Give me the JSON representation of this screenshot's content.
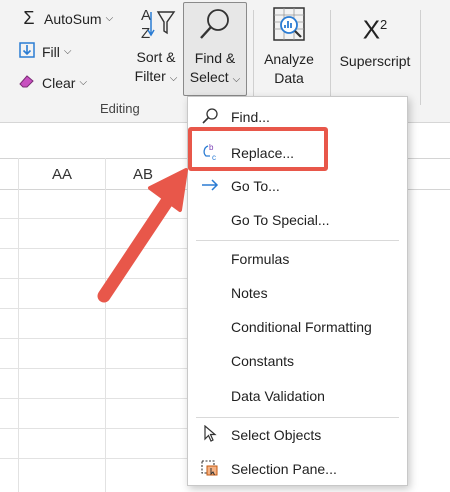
{
  "ribbon": {
    "autosum_label": "AutoSum",
    "fill_label": "Fill",
    "clear_label": "Clear",
    "sort_filter_line1": "Sort &",
    "sort_filter_line2": "Filter",
    "find_select_line1": "Find &",
    "find_select_line2": "Select",
    "analyze_line1": "Analyze",
    "analyze_line2": "Data",
    "superscript_label": "Superscript",
    "group_label": "Editing"
  },
  "sheet": {
    "columns": [
      "AA",
      "AB"
    ]
  },
  "menu": {
    "find": "Find...",
    "replace": "Replace...",
    "goto": "Go To...",
    "goto_special": "Go To Special...",
    "formulas": "Formulas",
    "notes": "Notes",
    "conditional_formatting": "Conditional Formatting",
    "constants": "Constants",
    "data_validation": "Data Validation",
    "select_objects": "Select Objects",
    "selection_pane": "Selection Pane..."
  },
  "colors": {
    "highlight": "#e8574a",
    "accent": "#2b7cd3"
  },
  "icons": {
    "find": "magnifier-icon",
    "replace": "replace-bc-icon",
    "goto": "arrow-right-icon",
    "select_objects": "cursor-arrow-icon",
    "selection_pane": "selection-pane-icon"
  }
}
